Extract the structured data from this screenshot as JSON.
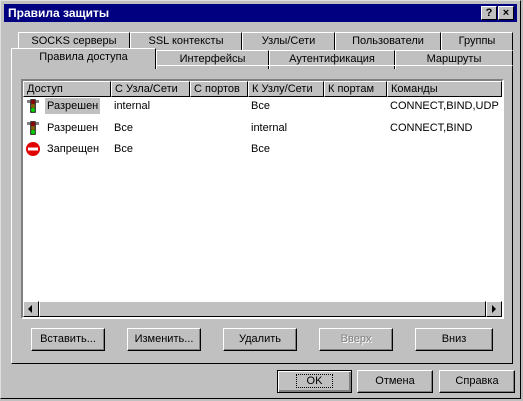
{
  "window": {
    "title": "Правила защиты",
    "help_label": "?",
    "close_label": "×"
  },
  "tabs_row1": [
    "SOCKS серверы",
    "SSL контексты",
    "Узлы/Сети",
    "Пользователи",
    "Группы"
  ],
  "tabs_row2": [
    "Правила доступа",
    "Интерфейсы",
    "Аутентификация",
    "Маршруты"
  ],
  "active_tab": "Правила доступа",
  "table": {
    "columns": [
      "Доступ",
      "С Узла/Сети",
      "С портов",
      "К Узлу/Сети",
      "К портам",
      "Команды"
    ],
    "rows": [
      {
        "icon": "traffic-light-icon",
        "access": "Разрешен",
        "from_host": "internal",
        "from_ports": "",
        "to_host": "Все",
        "to_ports": "",
        "commands": "CONNECT,BIND,UDP"
      },
      {
        "icon": "traffic-light-icon",
        "access": "Разрешен",
        "from_host": "Все",
        "from_ports": "",
        "to_host": "internal",
        "to_ports": "",
        "commands": "CONNECT,BIND"
      },
      {
        "icon": "no-entry-icon",
        "access": "Запрещен",
        "from_host": "Все",
        "from_ports": "",
        "to_host": "Все",
        "to_ports": "",
        "commands": ""
      }
    ]
  },
  "panel_buttons": {
    "insert": "Вставить...",
    "edit": "Изменить...",
    "delete": "Удалить",
    "up": "Вверх",
    "down": "Вниз"
  },
  "dialog_buttons": {
    "ok": "OK",
    "cancel": "Отмена",
    "help": "Справка"
  },
  "colors": {
    "titlebar": "#000080",
    "face": "#c0c0c0",
    "allow_green": "#00a000",
    "deny_red": "#e00000"
  }
}
